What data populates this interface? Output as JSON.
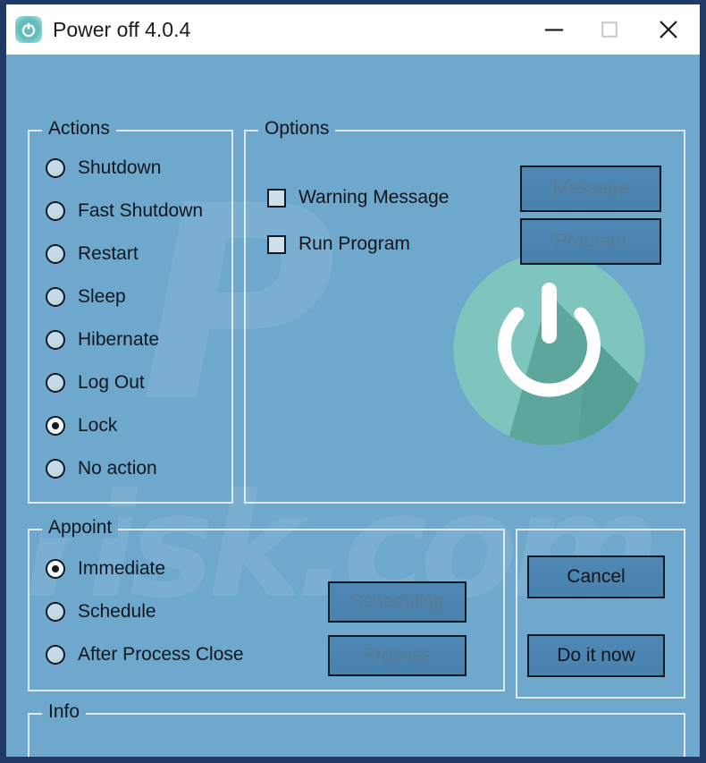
{
  "window": {
    "title": "Power off 4.0.4",
    "app_icon": "power-icon",
    "controls": {
      "minimize": "minimize-icon",
      "maximize": "maximize-icon",
      "close": "close-icon"
    }
  },
  "theme": {
    "client_background": "#6fa8cd",
    "frame_border": "#1f3a66",
    "titlebar_background": "#ffffff",
    "group_border": "#dfe9ef",
    "button_face": "#4e87b4",
    "button_border": "#141a24",
    "text": "#10161c",
    "disabled_text": "#5a7b93",
    "logo_teal": "#79c3bb",
    "logo_shadow": "#549a96"
  },
  "watermark": {
    "letter": "P",
    "tail": "risk.com"
  },
  "actions": {
    "legend": "Actions",
    "selected": "Lock",
    "items": [
      {
        "label": "Shutdown",
        "checked": false
      },
      {
        "label": "Fast Shutdown",
        "checked": false
      },
      {
        "label": "Restart",
        "checked": false
      },
      {
        "label": "Sleep",
        "checked": false
      },
      {
        "label": "Hibernate",
        "checked": false
      },
      {
        "label": "Log Out",
        "checked": false
      },
      {
        "label": "Lock",
        "checked": true
      },
      {
        "label": "No action",
        "checked": false
      }
    ]
  },
  "options": {
    "legend": "Options",
    "checkboxes": [
      {
        "label": "Warning Message",
        "checked": false
      },
      {
        "label": "Run Program",
        "checked": false
      }
    ],
    "buttons": [
      {
        "label": "Message",
        "enabled": false
      },
      {
        "label": "Program",
        "enabled": false
      }
    ]
  },
  "appoint": {
    "legend": "Appoint",
    "selected": "Immediate",
    "items": [
      {
        "label": "Immediate",
        "checked": true
      },
      {
        "label": "Schedule",
        "checked": false
      },
      {
        "label": "After Process Close",
        "checked": false
      }
    ],
    "buttons": [
      {
        "label": "Scheduling",
        "enabled": false
      },
      {
        "label": "Process",
        "enabled": false
      }
    ]
  },
  "commands": {
    "cancel": "Cancel",
    "do_it_now": "Do it now"
  },
  "info": {
    "legend": "Info",
    "text": ""
  }
}
